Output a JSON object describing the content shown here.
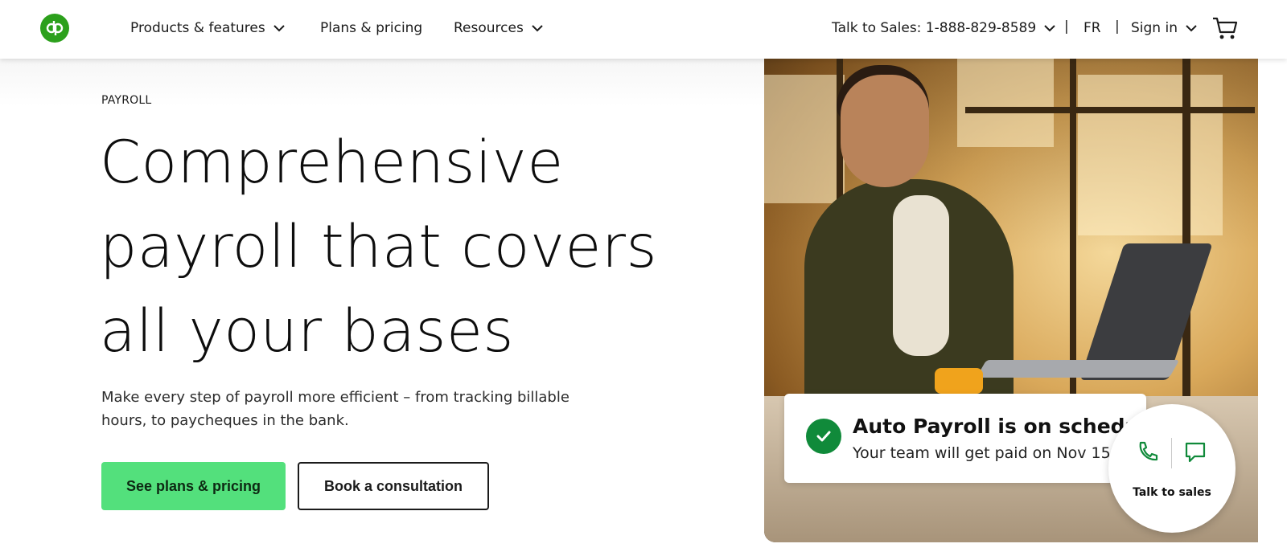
{
  "header": {
    "logo_text": "qb",
    "nav": {
      "products": "Products & features",
      "plans": "Plans & pricing",
      "resources": "Resources"
    },
    "talk_to_sales": "Talk to Sales: 1-888-829-8589",
    "separator": "|",
    "language": "FR",
    "sign_in": "Sign in"
  },
  "hero": {
    "eyebrow": "PAYROLL",
    "headline": "Comprehensive payroll that covers all your bases",
    "subtext": "Make every step of payroll more efficient – from tracking billable hours, to paycheques in the bank.",
    "primary_button": "See plans & pricing",
    "secondary_button": "Book a consultation"
  },
  "notification": {
    "title": "Auto Payroll is on schedule",
    "subtitle": "Your team will get paid on Nov 15."
  },
  "talk_widget": {
    "label": "Talk to sales"
  },
  "colors": {
    "brand_green": "#2ca01c",
    "cta_green": "#53e07c",
    "check_green": "#108a3a"
  }
}
